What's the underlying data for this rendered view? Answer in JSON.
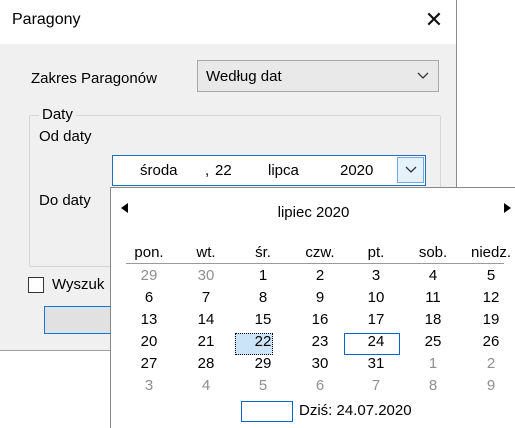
{
  "window": {
    "title": "Paragony"
  },
  "range": {
    "label": "Zakres Paragonów",
    "selected": "Według dat"
  },
  "group": {
    "title": "Daty",
    "from_label": "Od daty",
    "to_label": "Do daty"
  },
  "date_picker": {
    "weekday": "środa",
    "sep": ",",
    "day": "22",
    "month": "lipca",
    "year": "2020"
  },
  "checkbox": {
    "label": "Wyszuk"
  },
  "calendar": {
    "month_title": "lipiec 2020",
    "weekdays": [
      "pon.",
      "wt.",
      "śr.",
      "czw.",
      "pt.",
      "sob.",
      "niedz."
    ],
    "weeks": [
      [
        [
          "29",
          true
        ],
        [
          "30",
          true
        ],
        [
          "1",
          false
        ],
        [
          "2",
          false
        ],
        [
          "3",
          false
        ],
        [
          "4",
          false
        ],
        [
          "5",
          false
        ]
      ],
      [
        [
          "6",
          false
        ],
        [
          "7",
          false
        ],
        [
          "8",
          false
        ],
        [
          "9",
          false
        ],
        [
          "10",
          false
        ],
        [
          "11",
          false
        ],
        [
          "12",
          false
        ]
      ],
      [
        [
          "13",
          false
        ],
        [
          "14",
          false
        ],
        [
          "15",
          false
        ],
        [
          "16",
          false
        ],
        [
          "17",
          false
        ],
        [
          "18",
          false
        ],
        [
          "19",
          false
        ]
      ],
      [
        [
          "20",
          false
        ],
        [
          "21",
          false
        ],
        [
          "22",
          false
        ],
        [
          "23",
          false
        ],
        [
          "24",
          false
        ],
        [
          "25",
          false
        ],
        [
          "26",
          false
        ]
      ],
      [
        [
          "27",
          false
        ],
        [
          "28",
          false
        ],
        [
          "29",
          false
        ],
        [
          "30",
          false
        ],
        [
          "31",
          false
        ],
        [
          "1",
          true
        ],
        [
          "2",
          true
        ]
      ],
      [
        [
          "3",
          true
        ],
        [
          "4",
          true
        ],
        [
          "5",
          true
        ],
        [
          "6",
          true
        ],
        [
          "7",
          true
        ],
        [
          "8",
          true
        ],
        [
          "9",
          true
        ]
      ]
    ],
    "selected_day": "22",
    "today_day": "24",
    "today_text": "Dziś: 24.07.2020"
  }
}
